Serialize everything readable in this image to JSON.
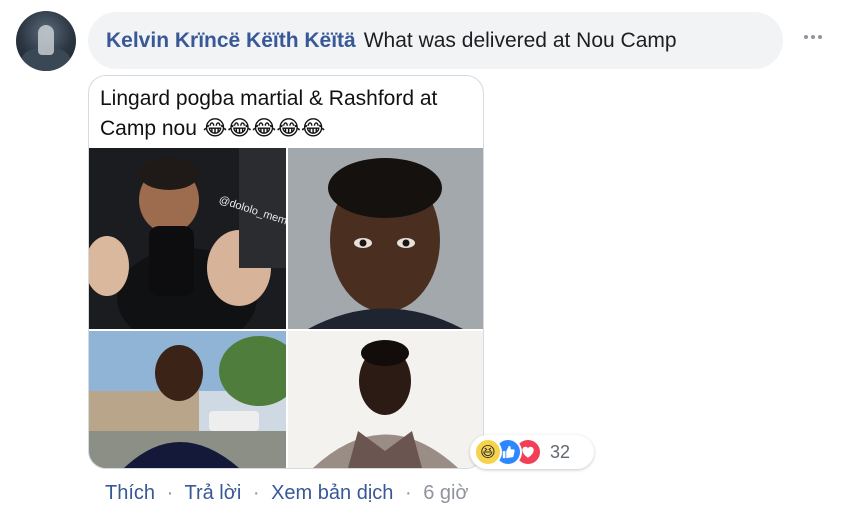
{
  "comment": {
    "author": "Kelvin Krïncë Këïth Këïtä",
    "text": "What was delivered at Nou Camp"
  },
  "image": {
    "caption": "Lingard pogba martial & Rashford at Camp nou 😂😂😂😂😂",
    "watermark": "@dololo_memes"
  },
  "reactions": {
    "icons": [
      "haha-icon",
      "like-icon",
      "love-icon"
    ],
    "count": "32"
  },
  "actions": {
    "like": "Thích",
    "reply": "Trả lời",
    "translate": "Xem bản dịch",
    "time": "6 giờ",
    "separator": "·"
  },
  "colors": {
    "author": "#385898",
    "bubble": "#f2f3f5",
    "meta": "#90949c",
    "like_blue": "#2d88ff",
    "love_red": "#f33e58",
    "haha_yellow": "#f7d34b"
  }
}
